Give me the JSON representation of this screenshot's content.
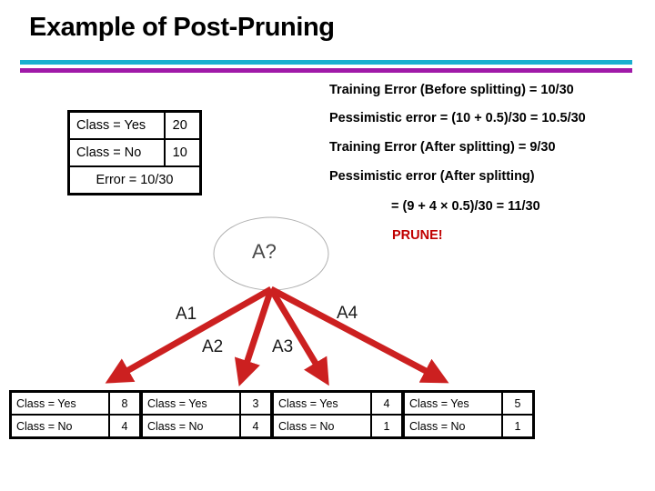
{
  "slide": {
    "title": "Example of Post-Pruning",
    "rule_top_color": "#19AFCF",
    "rule_bottom_color": "#A019A8"
  },
  "root_stats_table": {
    "rows": [
      {
        "label": "Class = Yes",
        "value": "20"
      },
      {
        "label": "Class = No",
        "value": "10"
      }
    ],
    "footer": "Error = 10/30"
  },
  "calculations": {
    "lines": [
      "Training Error (Before splitting) = 10/30",
      "Pessimistic error = (10 + 0.5)/30 = 10.5/30",
      "Training Error (After splitting) = 9/30",
      "Pessimistic error (After splitting)",
      "= (9 + 4 × 0.5)/30 = 11/30"
    ],
    "decision": "PRUNE!",
    "decision_color": "#C00000"
  },
  "tree": {
    "root_label": "A?",
    "root_text_color": "#4a4a4a",
    "ellipse_stroke": "#b0b0b0",
    "edge_color": "#CC2020",
    "edges": [
      {
        "label": "A1"
      },
      {
        "label": "A2"
      },
      {
        "label": "A3"
      },
      {
        "label": "A4"
      }
    ]
  },
  "leaf_tables": [
    {
      "rows": [
        {
          "label": "Class = Yes",
          "value": "8"
        },
        {
          "label": "Class = No",
          "value": "4"
        }
      ]
    },
    {
      "rows": [
        {
          "label": "Class = Yes",
          "value": "3"
        },
        {
          "label": "Class = No",
          "value": "4"
        }
      ]
    },
    {
      "rows": [
        {
          "label": "Class = Yes",
          "value": "4"
        },
        {
          "label": "Class = No",
          "value": "1"
        }
      ]
    },
    {
      "rows": [
        {
          "label": "Class = Yes",
          "value": "5"
        },
        {
          "label": "Class = No",
          "value": "1"
        }
      ]
    }
  ]
}
